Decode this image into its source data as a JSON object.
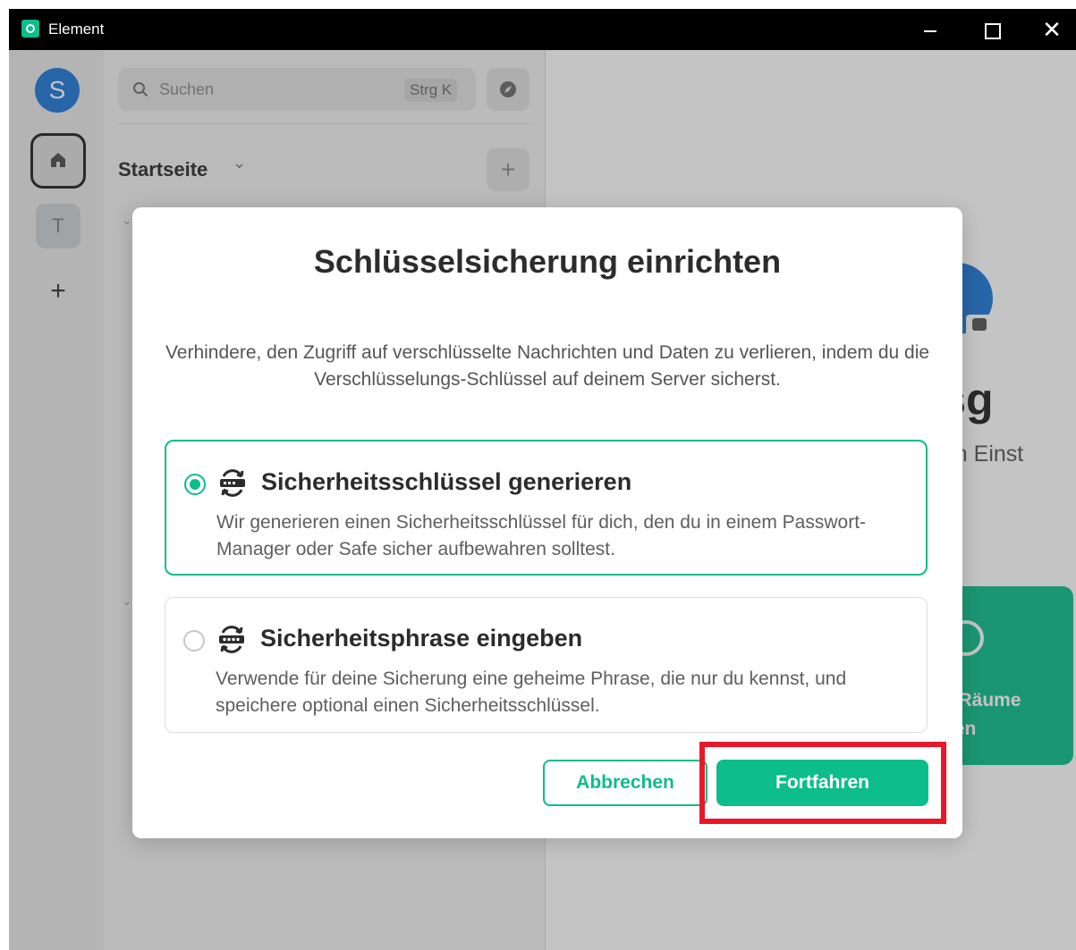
{
  "window": {
    "title": "Element",
    "controls": {
      "minimize": "minimize",
      "maximize": "maximize",
      "close": "✕"
    }
  },
  "spaces": {
    "avatar_letter": "S",
    "items": [
      {
        "letter": "T"
      }
    ],
    "add_label": "+"
  },
  "roomlist": {
    "search": {
      "placeholder": "Suchen",
      "shortcut": "Strg K"
    },
    "heading": "Startseite",
    "add_label": "+",
    "chevron": "⌄"
  },
  "homepage": {
    "heading_fragment": "en sg",
    "subtext_fragment": "den Einst",
    "card_text_line1": "e Räume",
    "card_text_line2": "den"
  },
  "dialog": {
    "title": "Schlüsselsicherung einrichten",
    "description": "Verhindere, den Zugriff auf verschlüsselte Nachrichten und Daten zu verlieren, indem du die Verschlüsselungs-Schlüssel auf deinem Server sicherst.",
    "options": [
      {
        "title": "Sicherheitsschlüssel generieren",
        "description": "Wir generieren einen Sicherheitsschlüssel für dich, den du in einem Passwort-Manager oder Safe sicher aufbewahren solltest.",
        "selected": true
      },
      {
        "title": "Sicherheitsphrase eingeben",
        "description": "Verwende für deine Sicherung eine geheime Phrase, die nur du kennst, und speichere optional einen Sicherheitsschlüssel.",
        "selected": false
      }
    ],
    "cancel_label": "Abbrechen",
    "continue_label": "Fortfahren"
  },
  "colors": {
    "accent": "#0dbd8b",
    "highlight": "#e8182a",
    "avatar": "#1f78d8"
  },
  "icons": {
    "home": "home-icon",
    "search": "search-icon",
    "explore": "compass-icon",
    "key": "key-icon",
    "passphrase": "password-icon"
  }
}
